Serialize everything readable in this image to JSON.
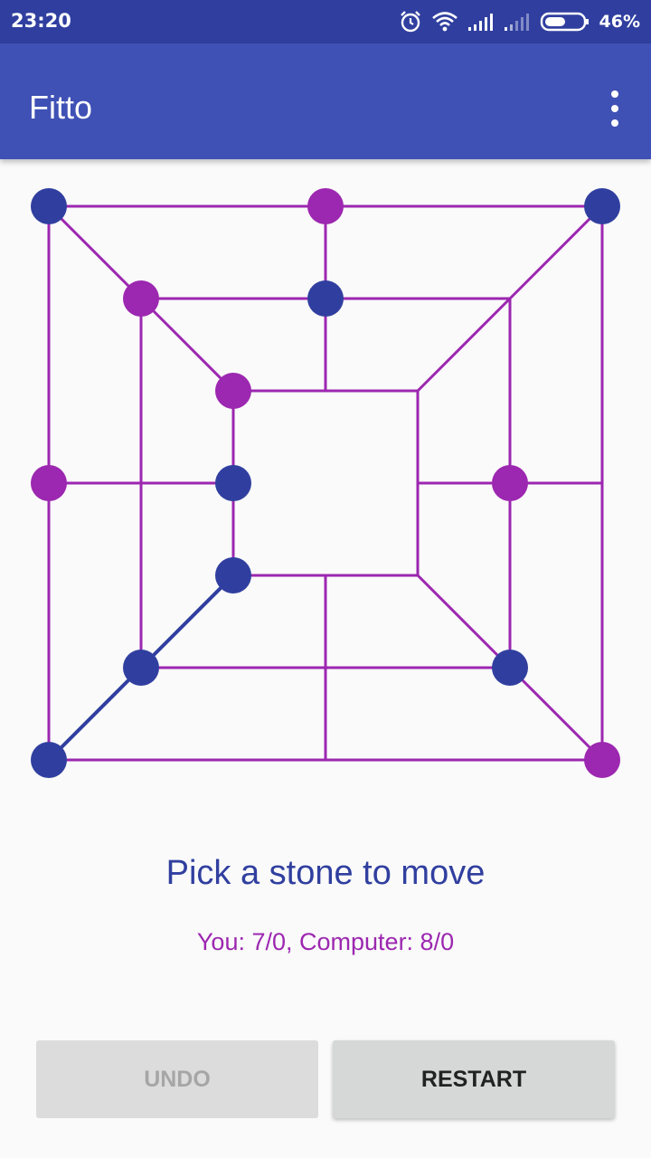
{
  "status_bar": {
    "time": "23:20",
    "battery_percent": "46%",
    "icons": [
      "alarm-icon",
      "wifi-icon",
      "signal-icon",
      "signal-icon",
      "battery-icon"
    ]
  },
  "app_bar": {
    "title": "Fitto",
    "menu_icon": "overflow-menu-icon"
  },
  "board": {
    "colors": {
      "line": "#9c27b0",
      "player_stone": "#303f9f",
      "computer_stone": "#9c27b0",
      "highlight_line": "#303f9f"
    },
    "rings": [
      "outer",
      "middle",
      "inner"
    ],
    "positions": [
      {
        "id": "outer-top-left",
        "stone": "blue"
      },
      {
        "id": "outer-top-middle",
        "stone": "purple"
      },
      {
        "id": "outer-top-right",
        "stone": "blue"
      },
      {
        "id": "outer-middle-left",
        "stone": "purple"
      },
      {
        "id": "outer-middle-right",
        "stone": "none"
      },
      {
        "id": "outer-bottom-left",
        "stone": "blue"
      },
      {
        "id": "outer-bottom-middle",
        "stone": "none"
      },
      {
        "id": "outer-bottom-right",
        "stone": "purple"
      },
      {
        "id": "middle-top-left",
        "stone": "purple"
      },
      {
        "id": "middle-top-middle",
        "stone": "blue"
      },
      {
        "id": "middle-top-right",
        "stone": "none"
      },
      {
        "id": "middle-middle-left",
        "stone": "none"
      },
      {
        "id": "middle-middle-right",
        "stone": "purple"
      },
      {
        "id": "middle-bottom-left",
        "stone": "blue"
      },
      {
        "id": "middle-bottom-middle",
        "stone": "none"
      },
      {
        "id": "middle-bottom-right",
        "stone": "blue"
      },
      {
        "id": "inner-top-left",
        "stone": "purple"
      },
      {
        "id": "inner-top-middle",
        "stone": "none"
      },
      {
        "id": "inner-top-right",
        "stone": "none"
      },
      {
        "id": "inner-middle-left",
        "stone": "blue"
      },
      {
        "id": "inner-middle-right",
        "stone": "none"
      },
      {
        "id": "inner-bottom-left",
        "stone": "blue"
      },
      {
        "id": "inner-bottom-middle",
        "stone": "none"
      },
      {
        "id": "inner-bottom-right",
        "stone": "none"
      }
    ],
    "highlighted_line": [
      "outer-bottom-left",
      "middle-bottom-left",
      "inner-bottom-left"
    ]
  },
  "game": {
    "prompt": "Pick a stone to move",
    "score": "You: 7/0, Computer: 8/0"
  },
  "buttons": {
    "undo_label": "UNDO",
    "undo_enabled": false,
    "restart_label": "RESTART"
  }
}
